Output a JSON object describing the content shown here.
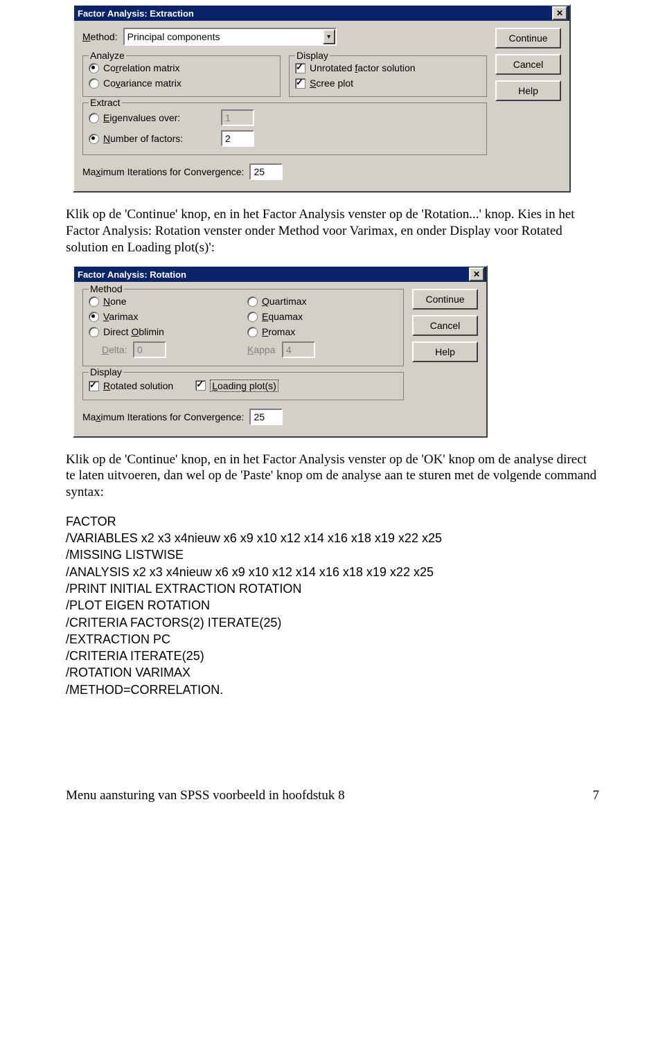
{
  "dialog1": {
    "title": "Factor Analysis: Extraction",
    "method_label": "Method:",
    "method_value": "Principal components",
    "buttons": {
      "continue": "Continue",
      "cancel": "Cancel",
      "help": "Help"
    },
    "analyze": {
      "legend": "Analyze",
      "correlation_matrix": "Correlation matrix",
      "covariance_matrix": "Covariance matrix"
    },
    "display": {
      "legend": "Display",
      "unrotated": "Unrotated factor solution",
      "scree": "Scree plot"
    },
    "extract": {
      "legend": "Extract",
      "eigenvalues_over": "Eigenvalues over:",
      "eigen_value": "1",
      "number_of_factors": "Number of factors:",
      "n_value": "2"
    },
    "maxiter_label": "Maximum Iterations for Convergence:",
    "maxiter_value": "25"
  },
  "para1": "Klik op de 'Continue' knop, en in het Factor Analysis venster op de 'Rotation...' knop. Kies in het Factor Analysis: Rotation venster onder Method voor Varimax, en onder Display voor Rotated solution en Loading plot(s)':",
  "dialog2": {
    "title": "Factor Analysis: Rotation",
    "buttons": {
      "continue": "Continue",
      "cancel": "Cancel",
      "help": "Help"
    },
    "method": {
      "legend": "Method",
      "none": "None",
      "varimax": "Varimax",
      "direct_oblimin": "Direct Oblimin",
      "quartimax": "Quartimax",
      "equamax": "Equamax",
      "promax": "Promax",
      "delta_label": "Delta:",
      "delta_value": "0",
      "kappa_label": "Kappa",
      "kappa_value": "4"
    },
    "display": {
      "legend": "Display",
      "rotated": "Rotated solution",
      "loading": "Loading plot(s)"
    },
    "maxiter_label": "Maximum Iterations for Convergence:",
    "maxiter_value": "25"
  },
  "para2": "Klik op de 'Continue' knop, en in het Factor Analysis venster op de 'OK' knop om de analyse direct te laten uitvoeren, dan wel op de 'Paste' knop om de analyse aan te sturen met de volgende command syntax:",
  "syntax": [
    "FACTOR",
    "  /VARIABLES x2 x3 x4nieuw x6 x9 x10 x12 x14 x16 x18 x19 x22 x25",
    "  /MISSING LISTWISE",
    "  /ANALYSIS x2 x3 x4nieuw x6 x9 x10 x12 x14 x16 x18 x19 x22 x25",
    "  /PRINT INITIAL EXTRACTION ROTATION",
    "  /PLOT EIGEN ROTATION",
    "  /CRITERIA FACTORS(2) ITERATE(25)",
    "  /EXTRACTION PC",
    "  /CRITERIA ITERATE(25)",
    "  /ROTATION VARIMAX",
    "  /METHOD=CORRELATION."
  ],
  "footer": {
    "left": "Menu aansturing van SPSS voorbeeld in hoofdstuk 8",
    "right": "7"
  }
}
